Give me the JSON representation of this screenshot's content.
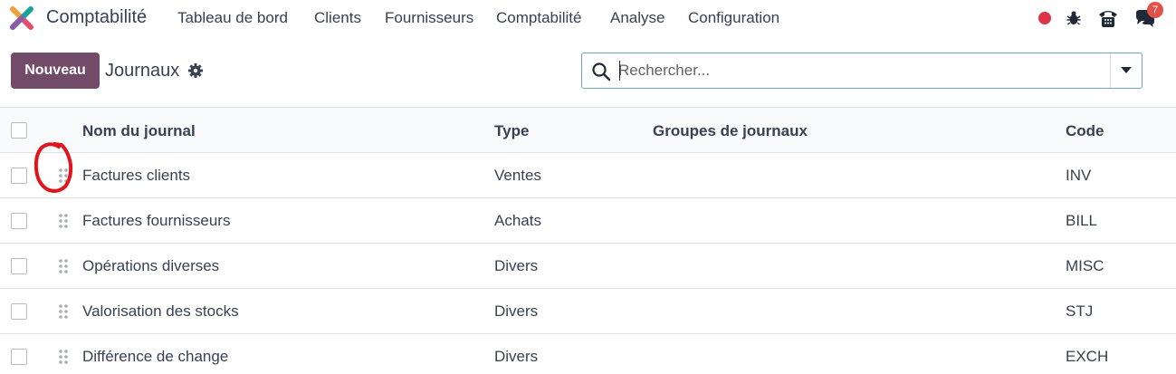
{
  "app": {
    "name": "Comptabilité"
  },
  "menu": [
    {
      "label": "Tableau de bord"
    },
    {
      "label": "Clients"
    },
    {
      "label": "Fournisseurs"
    },
    {
      "label": "Comptabilité"
    },
    {
      "label": "Analyse"
    },
    {
      "label": "Configuration"
    }
  ],
  "systray": {
    "status_icon": "red-status-dot-icon",
    "debug_icon": "bug-icon",
    "phone_icon": "phone-icon",
    "messages_icon": "chat-bubbles-icon",
    "messages_badge": "7"
  },
  "control_panel": {
    "new_button": "Nouveau",
    "title": "Journaux",
    "settings_icon": "gear-icon"
  },
  "search": {
    "placeholder": "Rechercher...",
    "value": "",
    "icon": "magnifier-icon",
    "toggle_icon": "caret-down-icon"
  },
  "table": {
    "columns": [
      "Nom du journal",
      "Type",
      "Groupes de journaux",
      "Code"
    ],
    "rows": [
      {
        "name": "Factures clients",
        "type": "Ventes",
        "groups": "",
        "code": "INV"
      },
      {
        "name": "Factures fournisseurs",
        "type": "Achats",
        "groups": "",
        "code": "BILL"
      },
      {
        "name": "Opérations diverses",
        "type": "Divers",
        "groups": "",
        "code": "MISC"
      },
      {
        "name": "Valorisation des stocks",
        "type": "Divers",
        "groups": "",
        "code": "STJ"
      },
      {
        "name": "Différence de change",
        "type": "Divers",
        "groups": "",
        "code": "EXCH"
      }
    ]
  },
  "colors": {
    "brand": "#714b67",
    "annotation": "#e0151d",
    "badge": "#e0534a",
    "status": "#dc3545"
  }
}
